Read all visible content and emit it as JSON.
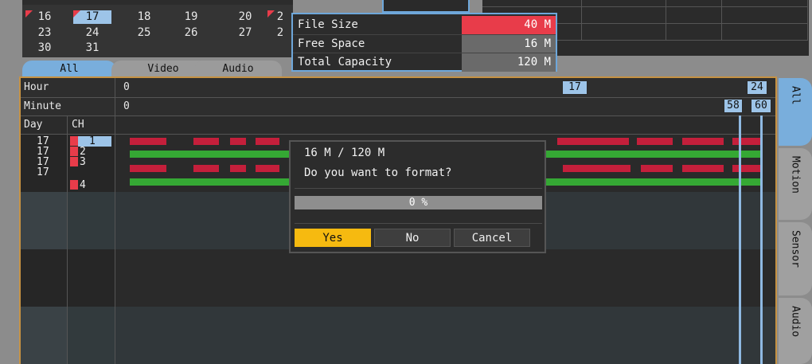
{
  "calendar": {
    "rows": [
      [
        "16",
        "17",
        "18",
        "19",
        "20",
        "2"
      ],
      [
        "23",
        "24",
        "25",
        "26",
        "27",
        "2"
      ],
      [
        "30",
        "31"
      ]
    ],
    "selected": "17"
  },
  "info_popup": {
    "rows": [
      {
        "label": "File Size",
        "value": "40 M",
        "color": "#e83c4a"
      },
      {
        "label": "Free Space",
        "value": "16 M",
        "color": "#6a6a6a"
      },
      {
        "label": "Total Capacity",
        "value": "120 M",
        "color": "#6a6a6a"
      }
    ]
  },
  "tabs": [
    "All",
    "Video",
    "Audio"
  ],
  "active_tab": "All",
  "timeline": {
    "hour_label": "Hour",
    "hour_start": "0",
    "hour_marker": "17",
    "hour_end": "24",
    "minute_label": "Minute",
    "minute_start": "0",
    "minute_markers": [
      "58",
      "60"
    ],
    "day_header": "Day",
    "ch_header": "CH",
    "channels": [
      {
        "day": "17",
        "ch": "1",
        "selected": true,
        "track": "red"
      },
      {
        "day": "17",
        "ch": "2",
        "selected": false,
        "track": "green"
      },
      {
        "day": "17",
        "ch": "3",
        "selected": false,
        "track": "red"
      },
      {
        "day": "17",
        "ch": "4",
        "selected": false,
        "track": "green"
      }
    ]
  },
  "side_tabs": [
    "All",
    "Motion",
    "Sensor",
    "Audio"
  ],
  "active_side_tab": "All",
  "dialog": {
    "title": "16 M / 120 M",
    "question": "Do you want to format?",
    "progress": "0 %",
    "progress_value": 0,
    "buttons": {
      "yes": "Yes",
      "no": "No",
      "cancel": "Cancel"
    }
  },
  "colors": {
    "accent": "#79aedc",
    "record": "#c41f3b",
    "event": "#35a834",
    "highlight": "#f6ba10"
  }
}
